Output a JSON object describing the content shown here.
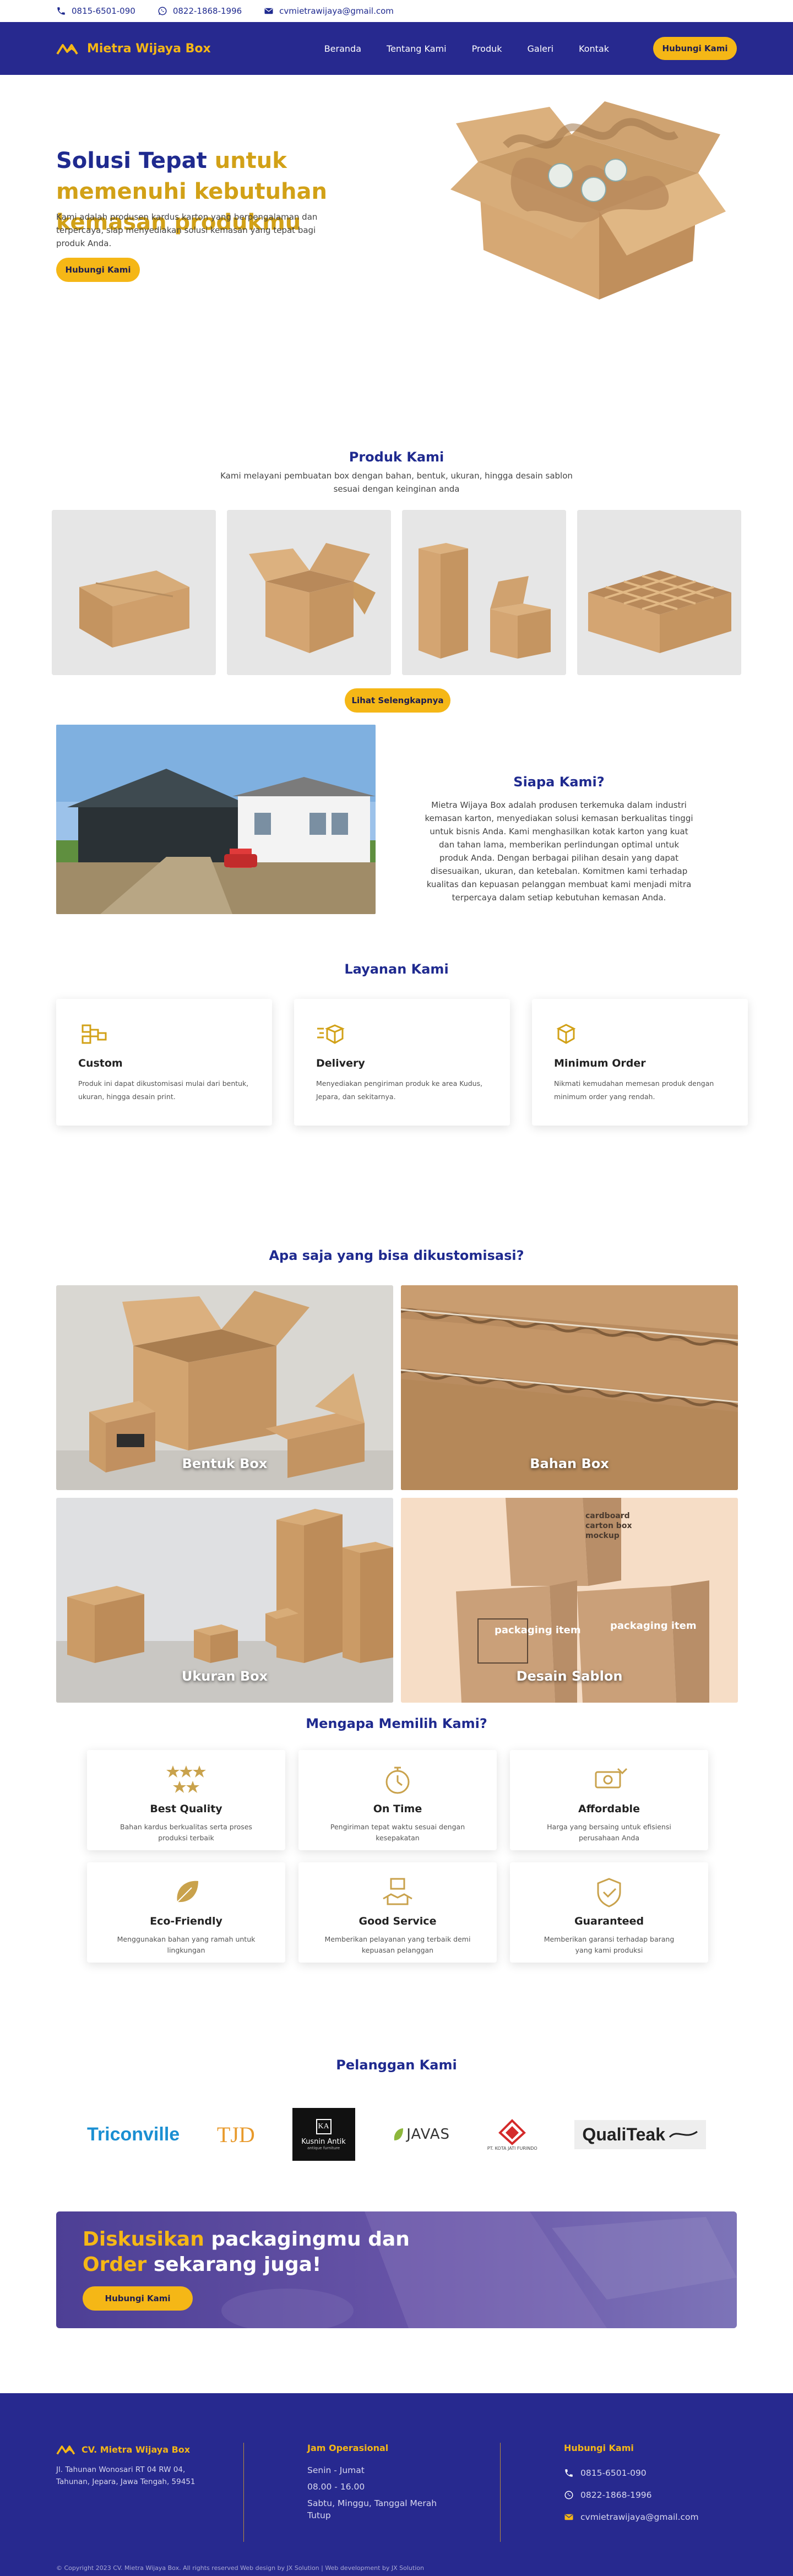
{
  "topbar": {
    "phone1": "0815-6501-090",
    "phone2": "0822-1868-1996",
    "email": "cvmietrawijaya@gmail.com"
  },
  "brand": {
    "name": "Mietra Wijaya Box"
  },
  "nav": {
    "items": [
      "Beranda",
      "Tentang Kami",
      "Produk",
      "Galeri",
      "Kontak"
    ],
    "cta": "Hubungi Kami"
  },
  "hero": {
    "title_main": "Solusi Tepat",
    "title_accent": " untuk memenuhi kebutuhan kemasan produkmu",
    "description": "Kami adalah produsen kardus karton yang berpengalaman dan terpercaya, siap menyediakan solusi kemasan yang tepat bagi produk Anda.",
    "cta": "Hubungi Kami"
  },
  "products": {
    "title": "Produk Kami",
    "subtitle": "Kami melayani pembuatan box dengan bahan, bentuk, ukuran, hingga desain sablon sesuai dengan keinginan anda",
    "cta": "Lihat Selengkapnya"
  },
  "about": {
    "title": "Siapa Kami?",
    "text": "Mietra Wijaya Box adalah produsen terkemuka dalam industri kemasan karton, menyediakan solusi kemasan berkualitas tinggi untuk bisnis Anda. Kami menghasilkan kotak karton yang kuat dan tahan lama, memberikan perlindungan optimal untuk produk Anda. Dengan berbagai pilihan desain yang dapat disesuaikan, ukuran, dan ketebalan. Komitmen kami terhadap kualitas dan kepuasan pelanggan membuat kami menjadi mitra terpercaya dalam setiap kebutuhan kemasan Anda."
  },
  "services": {
    "title": "Layanan Kami",
    "items": [
      {
        "title": "Custom",
        "desc": "Produk ini dapat dikustomisasi mulai dari bentuk, ukuran, hingga desain print."
      },
      {
        "title": "Delivery",
        "desc": "Menyediakan pengiriman produk ke area Kudus, Jepara, dan sekitarnya."
      },
      {
        "title": "Minimum Order",
        "desc": "Nikmati kemudahan memesan produk dengan minimum order yang rendah."
      }
    ]
  },
  "customize": {
    "title": "Apa saja yang bisa dikustomisasi?",
    "items": [
      "Bentuk Box",
      "Bahan Box",
      "Ukuran Box",
      "Desain Sablon"
    ],
    "mockup_texts": {
      "cardboard": "cardboard carton box mockup",
      "packaging1": "packaging item",
      "packaging2": "packaging item"
    }
  },
  "why": {
    "title": "Mengapa Memilih Kami?",
    "items": [
      {
        "title": "Best Quality",
        "desc": "Bahan kardus berkualitas serta proses produksi terbaik",
        "icon": "stars-icon"
      },
      {
        "title": "On Time",
        "desc": "Pengiriman tepat waktu sesuai dengan kesepakatan",
        "icon": "stopwatch-icon"
      },
      {
        "title": "Affordable",
        "desc": "Harga yang bersaing untuk efisiensi perusahaan Anda",
        "icon": "money-icon"
      },
      {
        "title": "Eco-Friendly",
        "desc": "Menggunakan bahan yang ramah untuk lingkungan",
        "icon": "leaf-icon"
      },
      {
        "title": "Good Service",
        "desc": "Memberikan pelayanan yang terbaik demi kepuasan pelanggan",
        "icon": "handshake-icon"
      },
      {
        "title": "Guaranteed",
        "desc": "Memberikan garansi terhadap barang yang kami produksi",
        "icon": "shield-check-icon"
      }
    ]
  },
  "customers": {
    "title": "Pelanggan Kami",
    "logos": [
      "Triconville",
      "TJD",
      "Kusnin Antik",
      "JAVAS",
      "PT. KOTA JATI FURINDO",
      "QualiTeak"
    ],
    "kusnin_sub": "antique furniture"
  },
  "cta": {
    "line1_accent": "Diskusikan",
    "line1_rest": " packagingmu dan",
    "line2_accent": "Order",
    "line2_rest": " sekarang juga!",
    "button": "Hubungi Kami"
  },
  "footer": {
    "company": "CV. Mietra Wijaya Box",
    "address": "Jl. Tahunan Wonosari RT 04 RW 04, Tahunan, Jepara, Jawa Tengah, 59451",
    "hours_title": "Jam Operasional",
    "hours": [
      "Senin - Jumat",
      "08.00 - 16.00",
      "Sabtu, Minggu, Tanggal Merah Tutup"
    ],
    "contact_title": "Hubungi Kami",
    "phone1": "0815-6501-090",
    "phone2": "0822-1868-1996",
    "email": "cvmietrawijaya@gmail.com",
    "copyright": "© Copyright 2023 CV. Mietra Wijaya Box. All rights reserved Web design by JX Solution | Web development by JX Solution"
  },
  "colors": {
    "navy": "#27298f",
    "gold": "#f5b716",
    "heading": "#1f2a8f"
  }
}
